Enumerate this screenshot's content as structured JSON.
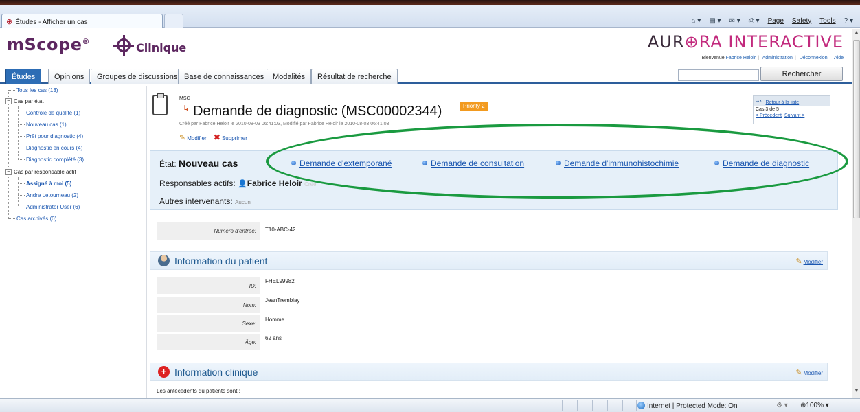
{
  "browser": {
    "tab_title": "Études - Afficher un cas",
    "commands": [
      "Page",
      "Safety",
      "Tools"
    ],
    "status_zone": "Internet | Protected Mode: On",
    "zoom": "100%"
  },
  "header": {
    "logo_name": "mScope",
    "logo_reg": "®",
    "logo_sub": "Clinique",
    "brand_a": "AUR",
    "brand_b": "RA INTERACTIVE",
    "welcome": "Bienvenue",
    "user": "Fabrice Heloir",
    "links": [
      "Administration",
      "Déconnexion",
      "Aide"
    ]
  },
  "nav": {
    "tabs": [
      "Études",
      "Opinions",
      "Groupes de discussions",
      "Base de connaissances",
      "Modalités",
      "Résultat de recherche"
    ],
    "search_button": "Rechercher"
  },
  "tree": {
    "all": "Tous les cas (13)",
    "by_state": "Cas par état",
    "state_items": [
      "Contrôle de qualité (1)",
      "Nouveau cas (1)",
      "Prêt pour diagnostic (4)",
      "Diagnostic en cours (4)",
      "Diagnostic complété (3)"
    ],
    "by_owner": "Cas par responsable actif",
    "owner_items": [
      "Assigné à moi (5)",
      "Andre Letourneau (2)",
      "Administrator User (6)"
    ],
    "archived": "Cas archivés (0)"
  },
  "case": {
    "type": "MSC",
    "title": "Demande de diagnostic (MSC00002344)",
    "priority": "Priority 2",
    "meta": "Créé par Fabrice Heloir le 2010-08-03 06:41:03, Modifié par Fabrice Heloir le 2010-08-03 06:41:03",
    "modify": "Modifier",
    "delete": "Supprimer"
  },
  "nav_box": {
    "back": "Retour à la liste",
    "position": "Cas 3 de 5",
    "prev": "< Précédent",
    "next": "Suivant >"
  },
  "state": {
    "label": "État:",
    "value": "Nouveau cas",
    "actions": [
      "Demande d'extemporané",
      "Demande de consultation",
      "Demande d'immunohistochimie",
      "Demande de diagnostic"
    ],
    "resp_label": "Responsables actifs:",
    "resp_value": "Fabrice Heloir",
    "resp_extra": "Créé",
    "other_label": "Autres intervenants:",
    "other_value": "Aucun"
  },
  "entry": {
    "label": "Numéro d'entrée:",
    "value": "T10-ABC-42"
  },
  "patient": {
    "title": "Information du patient",
    "modify": "Modifier",
    "fields": [
      {
        "label": "ID:",
        "value": "FHEL99982"
      },
      {
        "label": "Nom:",
        "value": "JeanTremblay"
      },
      {
        "label": "Sexe:",
        "value": "Homme"
      },
      {
        "label": "Âge:",
        "value": "62 ans"
      }
    ]
  },
  "clinic": {
    "title": "Information clinique",
    "modify": "Modifier",
    "text": "Les antécédents du patients sont :"
  },
  "colors": {
    "brand_purple": "#5d2760",
    "nav_blue": "#2d6db5",
    "priority_orange": "#f29a1f",
    "highlight_green": "#1a9a40"
  }
}
